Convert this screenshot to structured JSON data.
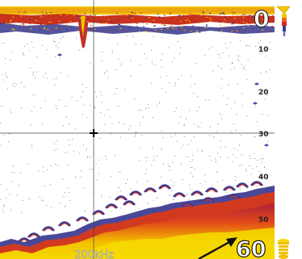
{
  "depth_scale": {
    "top_value": "0",
    "bottom_value": "60",
    "tick_labels": [
      "10",
      "20",
      "30",
      "40",
      "50"
    ]
  },
  "frequency_label": "200kHz",
  "colors": {
    "background": "#ffffff",
    "strong_echo": "#f2d000",
    "medium_echo": "#d83a1a",
    "weak_echo": "#3a3a9a",
    "cursor": "#333333"
  },
  "icons": {
    "top_gain_marker": "funnel-gain-icon",
    "bottom_range_marker": "range-bulb-icon",
    "cursor": "crosshair-icon",
    "depth_pointer": "arrow-pointer-icon"
  }
}
